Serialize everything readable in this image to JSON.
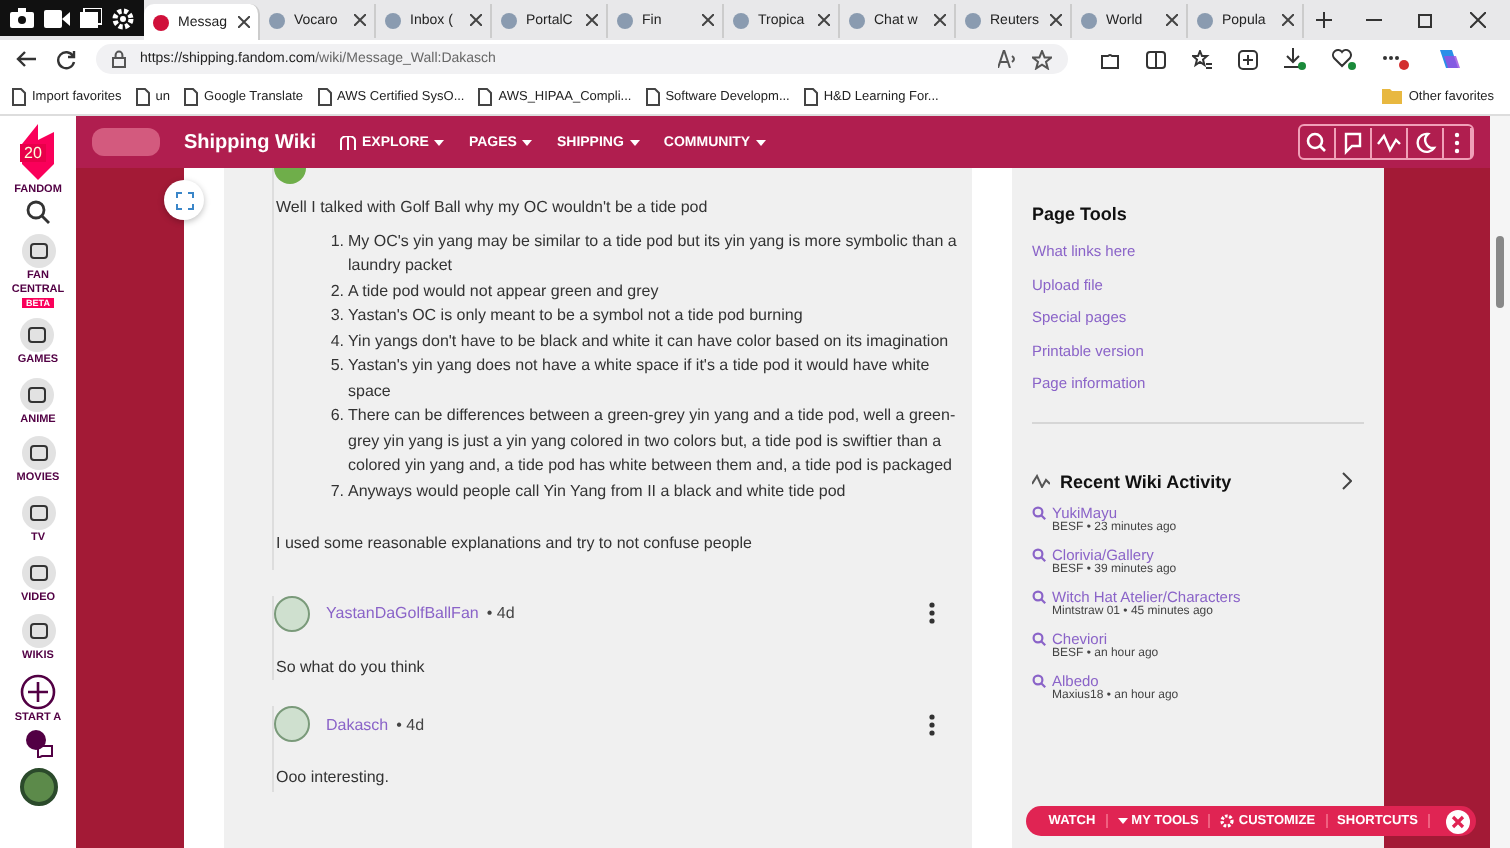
{
  "browser": {
    "tabs": [
      {
        "title": "Messag",
        "selected": true
      },
      {
        "title": "Vocaro",
        "selected": false
      },
      {
        "title": "Inbox (",
        "selected": false
      },
      {
        "title": "PortalC",
        "selected": false
      },
      {
        "title": "Fin",
        "selected": false
      },
      {
        "title": "Tropica",
        "selected": false
      },
      {
        "title": "Chat w",
        "selected": false
      },
      {
        "title": "Reuters",
        "selected": false
      },
      {
        "title": "World",
        "selected": false
      },
      {
        "title": "Popula",
        "selected": false
      }
    ],
    "address": {
      "host": "https://shipping.fandom.com",
      "path": "/wiki/Message_Wall:Dakasch"
    },
    "bookmarks": [
      "Import favorites",
      "un",
      "Google Translate",
      "AWS Certified SysO...",
      "AWS_HIPAA_Compli...",
      "Software Developm...",
      "H&D Learning For..."
    ],
    "other_favorites": "Other favorites"
  },
  "fandom_rail": {
    "badge": "20",
    "brand": "FANDOM",
    "items": [
      {
        "label": "FAN CENTRAL",
        "tag": "BETA",
        "kind": "nav"
      },
      {
        "label": "GAMES",
        "kind": "nav"
      },
      {
        "label": "ANIME",
        "kind": "nav"
      },
      {
        "label": "MOVIES",
        "kind": "nav"
      },
      {
        "label": "TV",
        "kind": "nav"
      },
      {
        "label": "VIDEO",
        "kind": "nav"
      },
      {
        "label": "WIKIS",
        "kind": "nav"
      },
      {
        "label": "START A",
        "kind": "create"
      }
    ]
  },
  "wiki_header": {
    "name": "Shipping Wiki",
    "nav": [
      "EXPLORE",
      "PAGES",
      "SHIPPING",
      "COMMUNITY"
    ]
  },
  "thread": {
    "intro": "Well I talked with Golf Ball why my OC wouldn't be a tide pod",
    "points": [
      {
        "number": "1.",
        "text": "My OC's yin yang may be similar to a tide pod but its yin yang is more symbolic than a laundry packet"
      },
      {
        "number": "2.",
        "text": "A tide pod would not appear green and grey"
      },
      {
        "number": "3.",
        "text": "Yastan's OC is only meant to be a symbol not a tide pod burning"
      },
      {
        "number": "4.",
        "text": "Yin yangs don't have to be black and white it can have color based on its imagination"
      },
      {
        "number": "5.",
        "text": "Yastan's yin yang does not have a white space if it's a tide pod it would have white space"
      },
      {
        "number": "6.",
        "text": "There can be differences between a green-grey yin yang and a tide pod, well a green-grey yin yang is just a yin yang colored in two colors but, a tide pod is swiftier than a colored yin yang and, a tide pod has white between them and, a tide pod is packaged"
      },
      {
        "number": "7.",
        "text": "Anyways would people call Yin Yang from II a black and white tide pod"
      }
    ],
    "outro": "I used some reasonable explanations and try to not confuse people",
    "replies": [
      {
        "author": "YastanDaGolfBallFan",
        "age": "• 4d",
        "text": "So what do you think"
      },
      {
        "author": "Dakasch",
        "age": "• 4d",
        "text": "Ooo interesting."
      }
    ]
  },
  "page_tools": {
    "title": "Page Tools",
    "links": [
      "What links here",
      "Upload file",
      "Special pages",
      "Printable version",
      "Page information"
    ]
  },
  "recent_activity": {
    "title": "Recent Wiki Activity",
    "items": [
      {
        "page": "YukiMayu",
        "meta": "BESF • 23 minutes ago"
      },
      {
        "page": "Clorivia/Gallery",
        "meta": "BESF • 39 minutes ago"
      },
      {
        "page": "Witch Hat Atelier/Characters",
        "meta": "Mintstraw 01 • 45 minutes ago"
      },
      {
        "page": "Cheviori",
        "meta": "BESF • an hour ago"
      },
      {
        "page": "Albedo",
        "meta": "Maxius18 • an hour ago"
      }
    ]
  },
  "toolbar": {
    "items": [
      {
        "label": "WATCH",
        "kind": "plain"
      },
      {
        "label": "MY TOOLS",
        "kind": "menu"
      },
      {
        "label": "CUSTOMIZE",
        "kind": "settings"
      },
      {
        "label": "SHORTCUTS",
        "kind": "plain"
      }
    ]
  }
}
